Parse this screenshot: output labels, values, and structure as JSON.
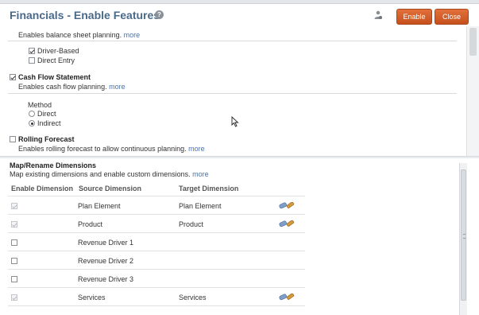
{
  "header": {
    "title": "Financials - Enable Features",
    "help_glyph": "?",
    "enable_label": "Enable",
    "close_label": "Close"
  },
  "balance_sheet": {
    "description": "Enables balance sheet planning.",
    "more": "more",
    "options": [
      {
        "label": "Driver-Based",
        "checked": true
      },
      {
        "label": "Direct Entry",
        "checked": false
      }
    ]
  },
  "cash_flow": {
    "label": "Cash Flow Statement",
    "checked": true,
    "description": "Enables cash flow planning.",
    "more": "more",
    "method_label": "Method",
    "methods": [
      {
        "label": "Direct",
        "selected": false
      },
      {
        "label": "Indirect",
        "selected": true
      }
    ]
  },
  "rolling_forecast": {
    "label": "Rolling Forecast",
    "checked": false,
    "description": "Enables rolling forecast to allow continuous planning.",
    "more": "more"
  },
  "map_rename": {
    "label": "Map/Rename Dimensions",
    "description": "Map existing dimensions and enable custom dimensions.",
    "more": "more",
    "columns": [
      "Enable Dimension",
      "Source Dimension",
      "Target Dimension"
    ],
    "rows": [
      {
        "enabled": true,
        "disabled": true,
        "source": "Plan Element",
        "target": "Plan Element",
        "edit_icon": true
      },
      {
        "enabled": true,
        "disabled": true,
        "source": "Product",
        "target": "Product",
        "edit_icon": true
      },
      {
        "enabled": false,
        "disabled": false,
        "source": "Revenue Driver 1",
        "target": "",
        "edit_icon": false
      },
      {
        "enabled": false,
        "disabled": false,
        "source": "Revenue Driver 2",
        "target": "",
        "edit_icon": false
      },
      {
        "enabled": false,
        "disabled": false,
        "source": "Revenue Driver 3",
        "target": "",
        "edit_icon": false
      },
      {
        "enabled": true,
        "disabled": true,
        "source": "Services",
        "target": "Services",
        "edit_icon": true
      }
    ]
  },
  "icons": {
    "help": "help-icon",
    "user": "user-icon",
    "edit": "edit-dimension-icon"
  },
  "colors": {
    "title": "#4a6a8a",
    "button": "#c6501c",
    "link": "#4a73a8"
  }
}
